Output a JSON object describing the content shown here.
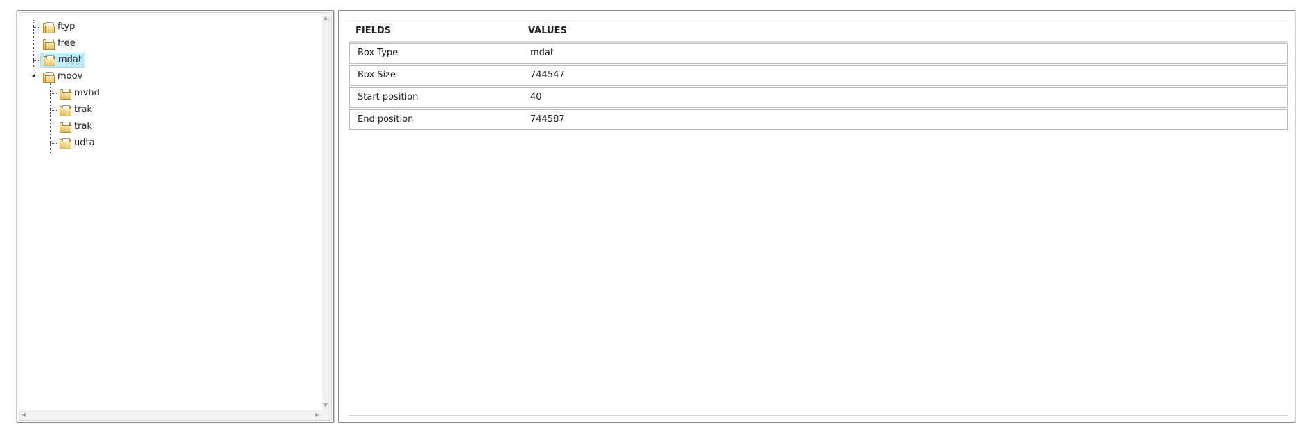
{
  "tree": {
    "nodes": [
      {
        "label": "ftyp",
        "selected": false
      },
      {
        "label": "free",
        "selected": false
      },
      {
        "label": "mdat",
        "selected": true
      },
      {
        "label": "moov",
        "selected": false,
        "expanded": true
      },
      {
        "label": "mvhd",
        "selected": false
      },
      {
        "label": "trak",
        "selected": false
      },
      {
        "label": "trak",
        "selected": false
      },
      {
        "label": "udta",
        "selected": false
      }
    ]
  },
  "details": {
    "header": {
      "fields": "FIELDS",
      "values": "VALUES"
    },
    "rows": [
      {
        "field": "Box Type",
        "value": "mdat"
      },
      {
        "field": "Box Size",
        "value": "744547"
      },
      {
        "field": "Start position",
        "value": "40"
      },
      {
        "field": "End position",
        "value": "744587"
      }
    ]
  },
  "icons": {
    "node": "folder-document-icon",
    "expander": "triangle-expanded-icon",
    "scroll_up": "chevron-up-icon",
    "scroll_down": "chevron-down-icon",
    "scroll_left": "chevron-left-icon",
    "scroll_right": "chevron-right-icon"
  },
  "colors": {
    "selection": "#beebff"
  }
}
